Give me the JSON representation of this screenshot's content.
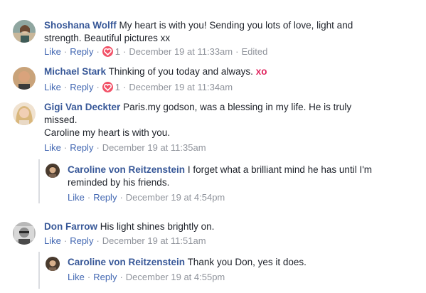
{
  "comments": [
    {
      "author": "Shoshana Wolff",
      "text": "My heart is with you! Sending you lots of love, light and",
      "text2": "strength. Beautiful pictures xx",
      "like": "Like",
      "reply": "Reply",
      "reactions": "1",
      "time": "December 19 at 11:33am",
      "edited": "Edited"
    },
    {
      "author": "Michael Stark",
      "text": "Thinking of you today and always.",
      "xo": "xo",
      "like": "Like",
      "reply": "Reply",
      "reactions": "1",
      "time": "December 19 at 11:34am"
    },
    {
      "author": "Gigi Van Deckter",
      "text": "Paris.my godson, was a blessing in my life. He is truly",
      "text2": "missed.",
      "text3": "Caroline my heart is with you.",
      "like": "Like",
      "reply": "Reply",
      "time": "December 19 at 11:35am",
      "reply_item": {
        "author": "Caroline von Reitzenstein",
        "text": "I forget what a brilliant mind he has until I'm",
        "text2": "reminded by his friends.",
        "like": "Like",
        "reply": "Reply",
        "time": "December 19 at 4:54pm"
      }
    },
    {
      "author": "Don Farrow",
      "text": "His light shines brightly on.",
      "like": "Like",
      "reply": "Reply",
      "time": "December 19 at 11:51am",
      "reply_item": {
        "author": "Caroline von Reitzenstein",
        "text": "Thank you Don, yes it does.",
        "like": "Like",
        "reply": "Reply",
        "time": "December 19 at 4:55pm"
      }
    }
  ],
  "colors": {
    "name": "#385898",
    "link": "#4267b2",
    "meta": "#90949c",
    "reaction": "#f25268"
  },
  "icons": [
    "heart-reaction-icon"
  ]
}
